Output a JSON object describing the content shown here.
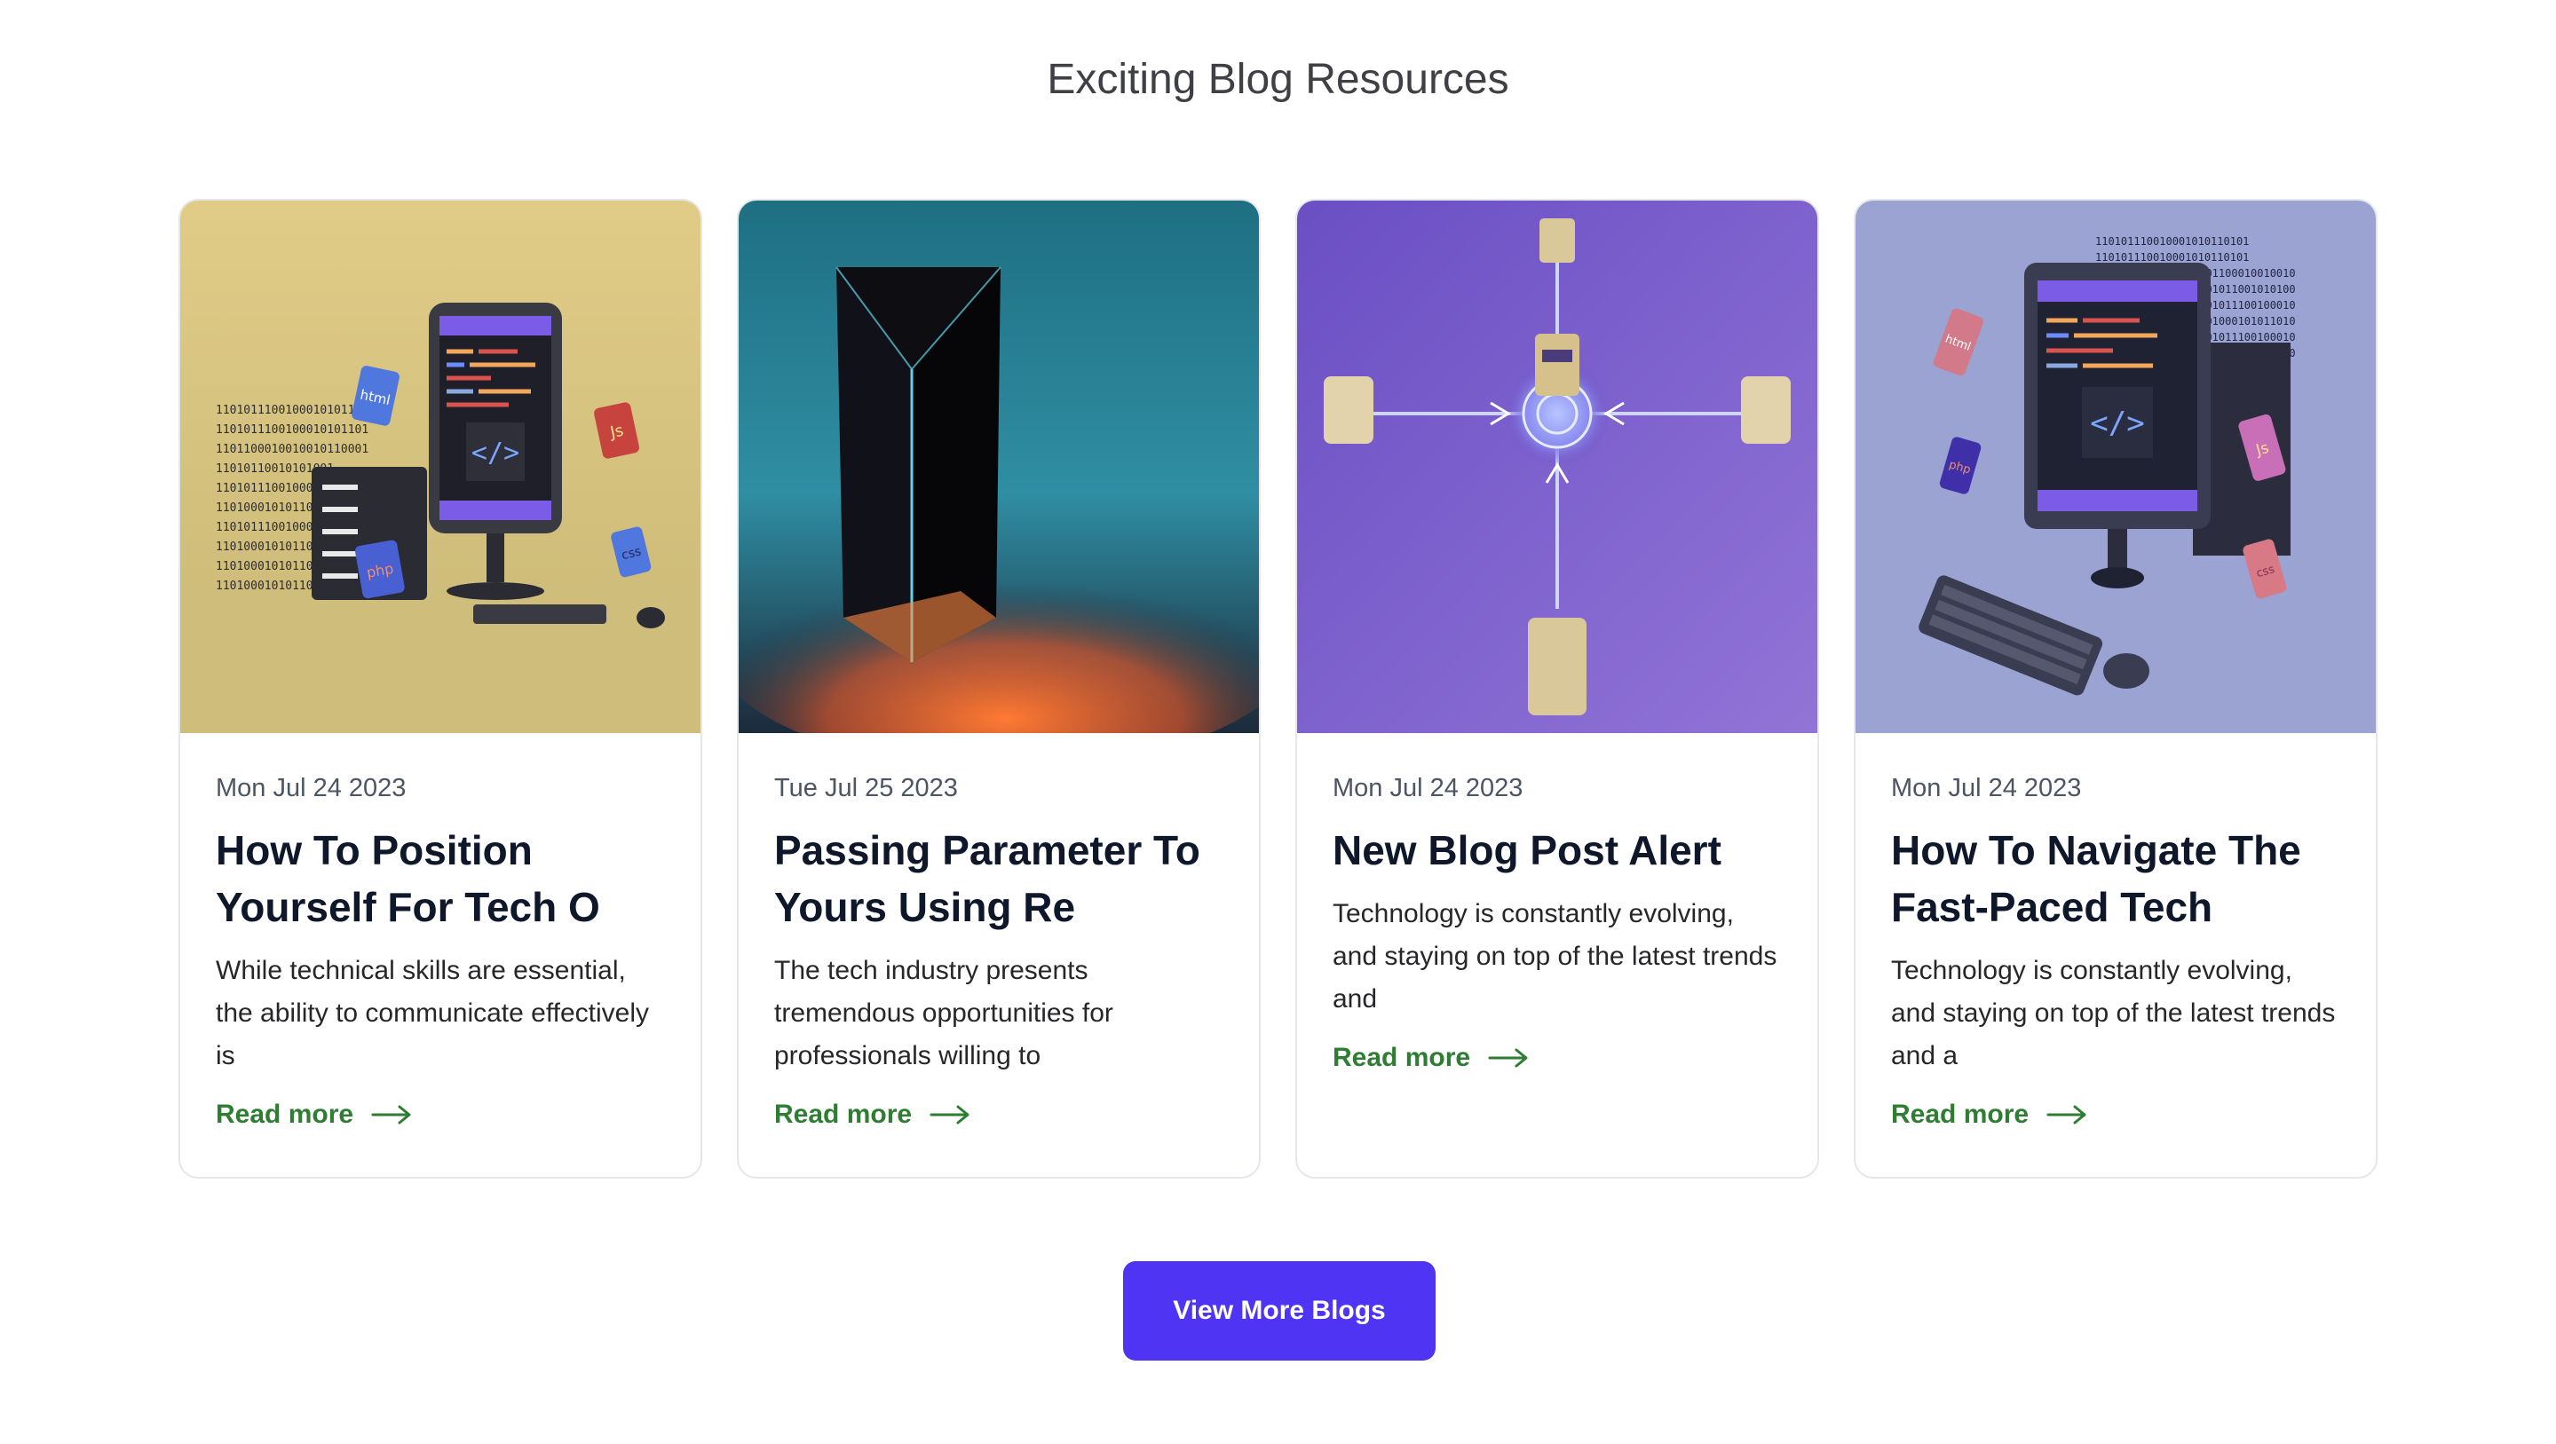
{
  "section": {
    "title": "Exciting Blog Resources"
  },
  "cards": [
    {
      "image_icon": "computer-server-code-illustration",
      "image_bg": "#dcc77f",
      "image_labels": {
        "html": "html",
        "js": "Js",
        "php": "php",
        "css": "css"
      },
      "date": "Mon Jul 24 2023",
      "title": "How To Position Yourself For Tech O",
      "excerpt": "While technical skills are essential, the ability to communicate effectively is",
      "read_more": "Read more"
    },
    {
      "image_icon": "glass-prism-illustration",
      "image_bg": "#2f7f92",
      "date": "Tue Jul 25 2023",
      "title": "Passing Parameter To Yours Using Re",
      "excerpt": "The tech industry presents tremendous opportunities for professionals willing to",
      "read_more": "Read more"
    },
    {
      "image_icon": "network-hub-illustration",
      "image_bg": "#7b61c9",
      "date": "Mon Jul 24 2023",
      "title": "New Blog Post Alert",
      "excerpt": "Technology is constantly evolving, and staying on top of the latest trends and",
      "read_more": "Read more"
    },
    {
      "image_icon": "desktop-computer-code-illustration",
      "image_bg": "#9aa3d1",
      "image_labels": {
        "html": "html",
        "js": "Js",
        "php": "php",
        "css": "css"
      },
      "date": "Mon Jul 24 2023",
      "title": "How To Navigate The Fast-Paced Tech",
      "excerpt": "Technology is constantly evolving, and staying on top of the latest trends and a",
      "read_more": "Read more"
    }
  ],
  "view_more": {
    "label": "View More Blogs"
  },
  "colors": {
    "accent": "#4f35f3",
    "read_more": "#2e7d32",
    "border": "#e5e7eb"
  }
}
